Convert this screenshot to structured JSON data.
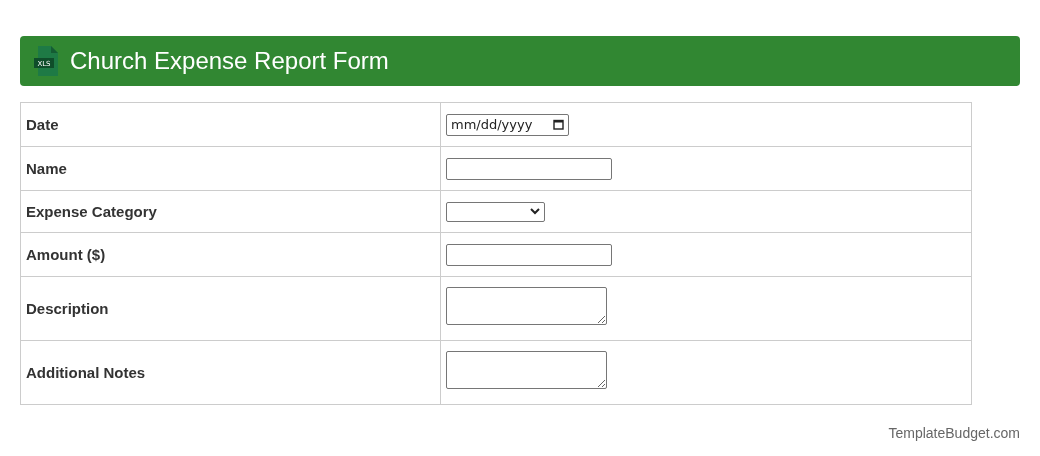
{
  "header": {
    "file_badge": "XLS",
    "title": "Church Expense Report Form"
  },
  "form": {
    "rows": [
      {
        "label": "Date",
        "kind": "date",
        "placeholder": "mm/dd/yyyy"
      },
      {
        "label": "Name",
        "kind": "text"
      },
      {
        "label": "Expense Category",
        "kind": "select"
      },
      {
        "label": "Amount ($)",
        "kind": "text"
      },
      {
        "label": "Description",
        "kind": "textarea"
      },
      {
        "label": "Additional Notes",
        "kind": "textarea"
      }
    ]
  },
  "footer": {
    "credit": "TemplateBudget.com"
  }
}
